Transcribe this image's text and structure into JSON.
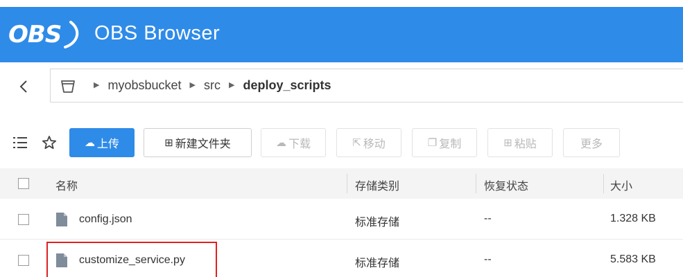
{
  "header": {
    "logo_text": "OBS",
    "title": "OBS Browser",
    "background": "#2f8be8"
  },
  "breadcrumb": {
    "back_icon": "chevron-left-icon",
    "bucket_icon": "bucket-icon",
    "items": [
      {
        "label": "myobsbucket"
      },
      {
        "label": "src"
      },
      {
        "label": "deploy_scripts"
      }
    ]
  },
  "toolbar": {
    "list_icon": "list-icon",
    "favorite_icon": "star-icon",
    "upload_label": "上传",
    "new_folder_label": "新建文件夹",
    "download_label": "下载",
    "move_label": "移动",
    "copy_label": "复制",
    "paste_label": "粘贴",
    "more_label": "更多"
  },
  "table": {
    "columns": [
      "名称",
      "存储类别",
      "恢复状态",
      "大小"
    ],
    "rows": [
      {
        "name": "config.json",
        "storage_class": "标准存储",
        "restore_status": "--",
        "size": "1.328 KB"
      },
      {
        "name": "customize_service.py",
        "storage_class": "标准存储",
        "restore_status": "--",
        "size": "5.583 KB"
      }
    ]
  },
  "colors": {
    "accent": "#2f8be8",
    "highlight_box": "#e02020"
  }
}
